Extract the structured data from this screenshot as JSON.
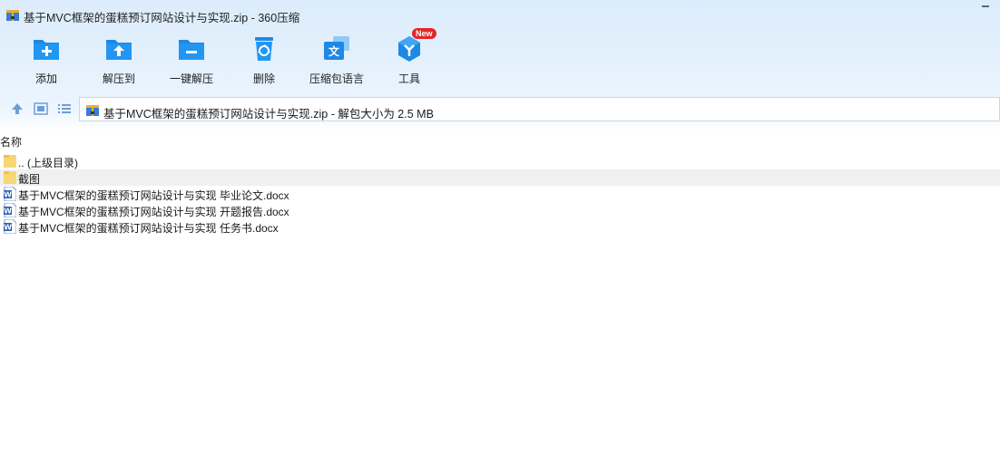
{
  "window": {
    "title": "基于MVC框架的蛋糕预订网站设计与实现.zip - 360压缩"
  },
  "toolbar": {
    "items": [
      {
        "label": "添加",
        "icon": "add-folder-icon"
      },
      {
        "label": "解压到",
        "icon": "extract-to-icon"
      },
      {
        "label": "一键解压",
        "icon": "one-click-extract-icon"
      },
      {
        "label": "删除",
        "icon": "delete-icon"
      },
      {
        "label": "压缩包语言",
        "icon": "archive-language-icon"
      },
      {
        "label": "工具",
        "icon": "tools-icon",
        "badge": "New"
      }
    ]
  },
  "address": {
    "path": "基于MVC框架的蛋糕预订网站设计与实现.zip - 解包大小为 2.5 MB"
  },
  "list": {
    "column_name": "名称",
    "rows": [
      {
        "name": ".. (上级目录)",
        "type": "folder"
      },
      {
        "name": "截图",
        "type": "folder"
      },
      {
        "name": "基于MVC框架的蛋糕预订网站设计与实现 毕业论文.docx",
        "type": "docx"
      },
      {
        "name": "基于MVC框架的蛋糕预订网站设计与实现 开题报告.docx",
        "type": "docx"
      },
      {
        "name": "基于MVC框架的蛋糕预订网站设计与实现 任务书.docx",
        "type": "docx"
      }
    ]
  },
  "colors": {
    "accent": "#1e88e5",
    "folder": "#f7d774",
    "badge": "#e5262a"
  }
}
